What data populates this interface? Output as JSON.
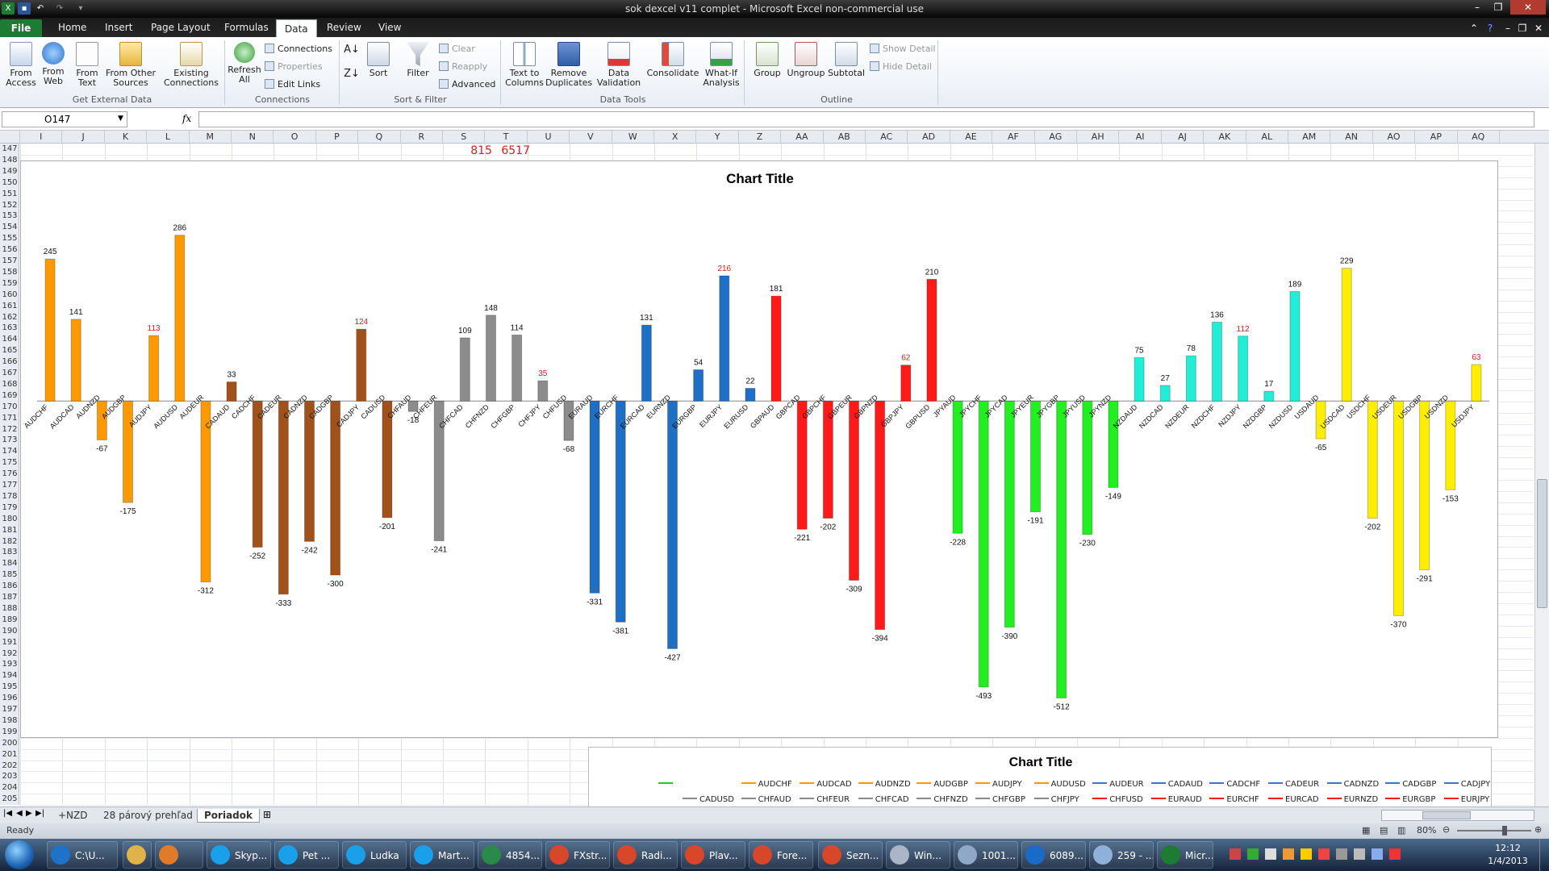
{
  "window": {
    "title": "sok dexcel v11  complet - Microsoft Excel non-commercial use"
  },
  "ribbon_tabs": {
    "file": "File",
    "home": "Home",
    "insert": "Insert",
    "page_layout": "Page Layout",
    "formulas": "Formulas",
    "data": "Data",
    "review": "Review",
    "view": "View"
  },
  "ribbon": {
    "from_access": "From Access",
    "from_web": "From Web",
    "from_text": "From Text",
    "from_other": "From Other Sources",
    "existing_connections": "Existing Connections",
    "group_external": "Get External Data",
    "refresh_all": "Refresh All",
    "connections": "Connections",
    "properties": "Properties",
    "edit_links": "Edit Links",
    "group_connections": "Connections",
    "sort": "Sort",
    "filter": "Filter",
    "clear": "Clear",
    "reapply": "Reapply",
    "advanced": "Advanced",
    "group_sort": "Sort & Filter",
    "text_to_columns": "Text to Columns",
    "remove_duplicates": "Remove Duplicates",
    "data_validation": "Data Validation",
    "consolidate": "Consolidate",
    "what_if": "What-If Analysis",
    "group_tools": "Data Tools",
    "group": "Group",
    "ungroup": "Ungroup",
    "subtotal": "Subtotal",
    "show_detail": "Show Detail",
    "hide_detail": "Hide Detail",
    "group_outline": "Outline"
  },
  "formula_bar": {
    "name_box": "O147",
    "fx": "fx",
    "formula": ""
  },
  "columns": [
    "I",
    "J",
    "K",
    "L",
    "M",
    "N",
    "O",
    "P",
    "Q",
    "R",
    "S",
    "T",
    "U",
    "V",
    "W",
    "X",
    "Y",
    "Z",
    "AA",
    "AB",
    "AC",
    "AD",
    "AE",
    "AF",
    "AG",
    "AH",
    "AI",
    "AJ",
    "AK",
    "AL",
    "AM",
    "AN",
    "AO",
    "AP",
    "AQ"
  ],
  "rows": [
    "147",
    "148",
    "149",
    "150",
    "151",
    "152",
    "153",
    "154",
    "155",
    "156",
    "157",
    "158",
    "159",
    "160",
    "161",
    "162",
    "163",
    "164",
    "165",
    "166",
    "167",
    "168",
    "169",
    "170",
    "171",
    "172",
    "173",
    "174",
    "175",
    "176",
    "177",
    "178",
    "179",
    "180",
    "181",
    "182",
    "183",
    "184",
    "185",
    "186",
    "187",
    "188",
    "189",
    "190",
    "191",
    "192",
    "193",
    "194",
    "195",
    "196",
    "197",
    "198",
    "199",
    "200",
    "201",
    "202",
    "203",
    "204",
    "205"
  ],
  "cells": {
    "r147": "815",
    "s147": "6517"
  },
  "chart_data": [
    {
      "type": "bar",
      "title": "Chart Title",
      "categories": [
        "AUDCHF",
        "AUDCAD",
        "AUDNZD",
        "AUDGBP",
        "AUDJPY",
        "AUDUSD",
        "AUDEUR",
        "CADAUD",
        "CADCHF",
        "CADEUR",
        "CADNZD",
        "CADGBP",
        "CADJPY",
        "CADUSD",
        "CHFAUD",
        "CHFEUR",
        "CHFCAD",
        "CHFNZD",
        "CHFGBP",
        "CHFJPY",
        "CHFUSD",
        "EURAUD",
        "EURCHF",
        "EURCAD",
        "EURNZD",
        "EURGBP",
        "EURJPY",
        "EURUSD",
        "GBPAUD",
        "GBPCAD",
        "GBPCHF",
        "GBPEUR",
        "GBPNZD",
        "GBPJPY",
        "GBPUSD",
        "JPYAUD",
        "JPYCHF",
        "JPYCAD",
        "JPYEUR",
        "JPYGBP",
        "JPYUSD",
        "JPYNZD",
        "NZDAUD",
        "NZDCAD",
        "NZDEUR",
        "NZDCHF",
        "NZDJPY",
        "NZDGBP",
        "NZDUSD",
        "USDAUD",
        "USDCAD",
        "USDCHF",
        "USDEUR",
        "USDGBP",
        "USDNZD",
        "USDJPY"
      ],
      "values": [
        245,
        141,
        -67,
        -175,
        113,
        286,
        -312,
        33,
        -252,
        -333,
        -242,
        -300,
        124,
        -201,
        -18,
        -241,
        109,
        148,
        114,
        35,
        -68,
        -331,
        -381,
        131,
        -427,
        54,
        216,
        22,
        181,
        -221,
        -202,
        -309,
        -394,
        62,
        210,
        -228,
        -493,
        -390,
        -191,
        -512,
        -230,
        -149,
        75,
        27,
        78,
        136,
        112,
        17,
        189,
        -65,
        229,
        -202,
        -370,
        -291,
        -153,
        63
      ],
      "labels": [
        "245",
        "141",
        "-67",
        "-175",
        "113",
        "286",
        "-312",
        "33",
        "-252",
        "-333",
        "-242",
        "-300",
        "124",
        "-201",
        "-18",
        "-241",
        "109",
        "148",
        "114",
        "35",
        "-68",
        "-331",
        "-381",
        "131",
        "-427",
        "54",
        "216",
        "22",
        "181",
        "-221",
        "-202",
        "-309",
        "-394",
        "62",
        "210",
        "-228",
        "-493",
        "-390",
        "-191",
        "-512",
        "-230",
        "-149",
        "75",
        "27",
        "78",
        "136",
        "112",
        "17",
        "189",
        "-65",
        "229",
        "-202",
        "-370",
        "-291",
        "-153",
        "63"
      ],
      "highlight_labels": [
        4,
        12,
        19,
        26,
        33,
        46,
        55
      ],
      "bar_colors": [
        "#FF9900",
        "#FF9900",
        "#FF9900",
        "#FF9900",
        "#FF9900",
        "#FF9900",
        "#FF9900",
        "#A0521A",
        "#A0521A",
        "#A0521A",
        "#A0521A",
        "#A0521A",
        "#A0521A",
        "#A0521A",
        "#8C8C8C",
        "#8C8C8C",
        "#8C8C8C",
        "#8C8C8C",
        "#8C8C8C",
        "#8C8C8C",
        "#8C8C8C",
        "#1F6FC5",
        "#1F6FC5",
        "#1F6FC5",
        "#1F6FC5",
        "#1F6FC5",
        "#1F6FC5",
        "#1F6FC5",
        "#FF1A1A",
        "#FF1A1A",
        "#FF1A1A",
        "#FF1A1A",
        "#FF1A1A",
        "#FF1A1A",
        "#FF1A1A",
        "#22EE22",
        "#22EE22",
        "#22EE22",
        "#22EE22",
        "#22EE22",
        "#22EE22",
        "#22EE22",
        "#22EED8",
        "#22EED8",
        "#22EED8",
        "#22EED8",
        "#22EED8",
        "#22EED8",
        "#22EED8",
        "#FFEE00",
        "#FFEE00",
        "#FFEE00",
        "#FFEE00",
        "#FFEE00",
        "#FFEE00",
        "#FFEE00"
      ],
      "ylim": [
        -560,
        330
      ],
      "grid": false
    },
    {
      "type": "line",
      "title": "Chart Title",
      "legend": [
        {
          "name": "",
          "color": "#22CC22"
        },
        {
          "name": "AUDCHF",
          "color": "#FF9900"
        },
        {
          "name": "AUDCAD",
          "color": "#FF9900"
        },
        {
          "name": "AUDNZD",
          "color": "#FF9900"
        },
        {
          "name": "AUDGBP",
          "color": "#FF9900"
        },
        {
          "name": "AUDJPY",
          "color": "#FF9900"
        },
        {
          "name": "AUDUSD",
          "color": "#FF9900"
        },
        {
          "name": "AUDEUR",
          "color": "#4472C4"
        },
        {
          "name": "CADAUD",
          "color": "#4472C4"
        },
        {
          "name": "CADCHF",
          "color": "#4472C4"
        },
        {
          "name": "CADEUR",
          "color": "#4472C4"
        },
        {
          "name": "CADNZD",
          "color": "#4472C4"
        },
        {
          "name": "CADGBP",
          "color": "#4472C4"
        },
        {
          "name": "CADJPY",
          "color": "#4472C4"
        },
        {
          "name": "CADUSD",
          "color": "#888888"
        },
        {
          "name": "CHFAUD",
          "color": "#888888"
        },
        {
          "name": "CHFEUR",
          "color": "#888888"
        },
        {
          "name": "CHFCAD",
          "color": "#888888"
        },
        {
          "name": "CHFNZD",
          "color": "#888888"
        },
        {
          "name": "CHFGBP",
          "color": "#888888"
        },
        {
          "name": "CHFJPY",
          "color": "#888888"
        },
        {
          "name": "CHFUSD",
          "color": "#FF1A1A"
        },
        {
          "name": "EURAUD",
          "color": "#FF1A1A"
        },
        {
          "name": "EURCHF",
          "color": "#FF1A1A"
        },
        {
          "name": "EURCAD",
          "color": "#FF1A1A"
        },
        {
          "name": "EURNZD",
          "color": "#FF1A1A"
        },
        {
          "name": "EURGBP",
          "color": "#FF1A1A"
        },
        {
          "name": "EURJPY",
          "color": "#FF1A1A"
        }
      ]
    }
  ],
  "sheet_tabs": [
    "+NZD",
    "28 párový prehľad",
    "Poriadok"
  ],
  "status": {
    "ready": "Ready",
    "zoom": "80%"
  },
  "taskbar": {
    "items": [
      "C:\\U...",
      "",
      "",
      "Skyp...",
      "Pet ...",
      "Ludka",
      "Mart...",
      "4854...",
      "FXstr...",
      "Radi...",
      "Plav...",
      "Fore...",
      "Sezn...",
      "Win...",
      "1001...",
      "6089...",
      "259 - ...",
      "Micr..."
    ],
    "icon_colors": [
      "#1e73c9",
      "#e0b24a",
      "#e07b2a",
      "#1aa0e8",
      "#1aa0e8",
      "#1aa0e8",
      "#1aa0e8",
      "#2a8a4a",
      "#d8472a",
      "#d8472a",
      "#d8472a",
      "#d8472a",
      "#d8472a",
      "#aab6c8",
      "#8fa8c8",
      "#1a6ac8",
      "#8fb0d8",
      "#1e7b34"
    ],
    "time": "12:12",
    "date": "1/4/2013"
  }
}
